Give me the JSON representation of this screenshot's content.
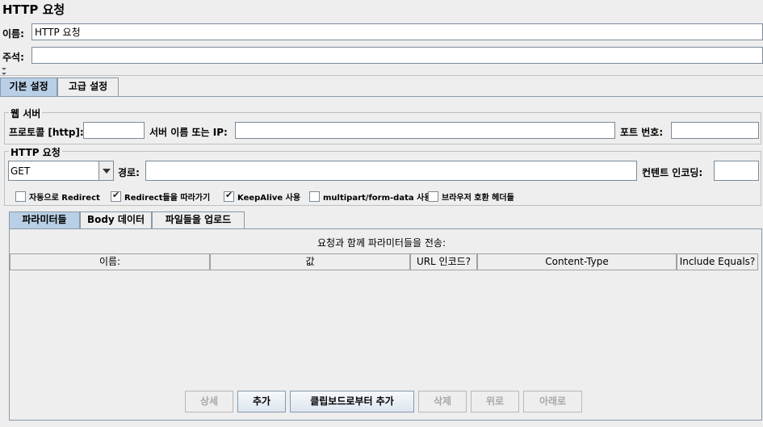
{
  "header": {
    "title": "HTTP 요청",
    "name_label": "이름:",
    "name_value": "HTTP 요청",
    "comment_label": "주석:",
    "comment_value": ""
  },
  "tabs": [
    {
      "label": "기본 설정",
      "active": true
    },
    {
      "label": "고급 설정",
      "active": false
    }
  ],
  "web_server": {
    "group_title": "웹 서버",
    "protocol_label": "프로토콜 [http]:",
    "protocol_value": "",
    "server_label": "서버 이름 또는 IP:",
    "server_value": "",
    "port_label": "포트 번호:",
    "port_value": ""
  },
  "http_request": {
    "group_title": "HTTP 요청",
    "method_value": "GET",
    "path_label": "경로:",
    "path_value": "",
    "encoding_label": "컨텐트 인코딩:",
    "encoding_value": ""
  },
  "checkboxes": [
    {
      "label": "자동으로 Redirect",
      "checked": false
    },
    {
      "label": "Redirect들을 따라가기",
      "checked": true
    },
    {
      "label": "KeepAlive 사용",
      "checked": true
    },
    {
      "label": "multipart/form-data 사용",
      "checked": false
    },
    {
      "label": "브라우저 호환 헤더들",
      "checked": false
    }
  ],
  "sub_tabs": [
    {
      "label": "파라미터들",
      "active": true
    },
    {
      "label": "Body 데이터",
      "active": false
    },
    {
      "label": "파일들을 업로드",
      "active": false
    }
  ],
  "params": {
    "caption": "요청과 함께 파라미터들을 전송:",
    "columns": [
      "이름:",
      "값",
      "URL 인코드?",
      "Content-Type",
      "Include Equals?"
    ]
  },
  "buttons": [
    {
      "label": "상세",
      "enabled": false
    },
    {
      "label": "추가",
      "enabled": true
    },
    {
      "label": "클립보드로부터 추가",
      "enabled": true
    },
    {
      "label": "삭제",
      "enabled": false
    },
    {
      "label": "위로",
      "enabled": false
    },
    {
      "label": "아래로",
      "enabled": false
    }
  ],
  "colors": {
    "background": "#eeeeee",
    "active_tab": "#b8cfe5",
    "border": "#8899aa"
  }
}
